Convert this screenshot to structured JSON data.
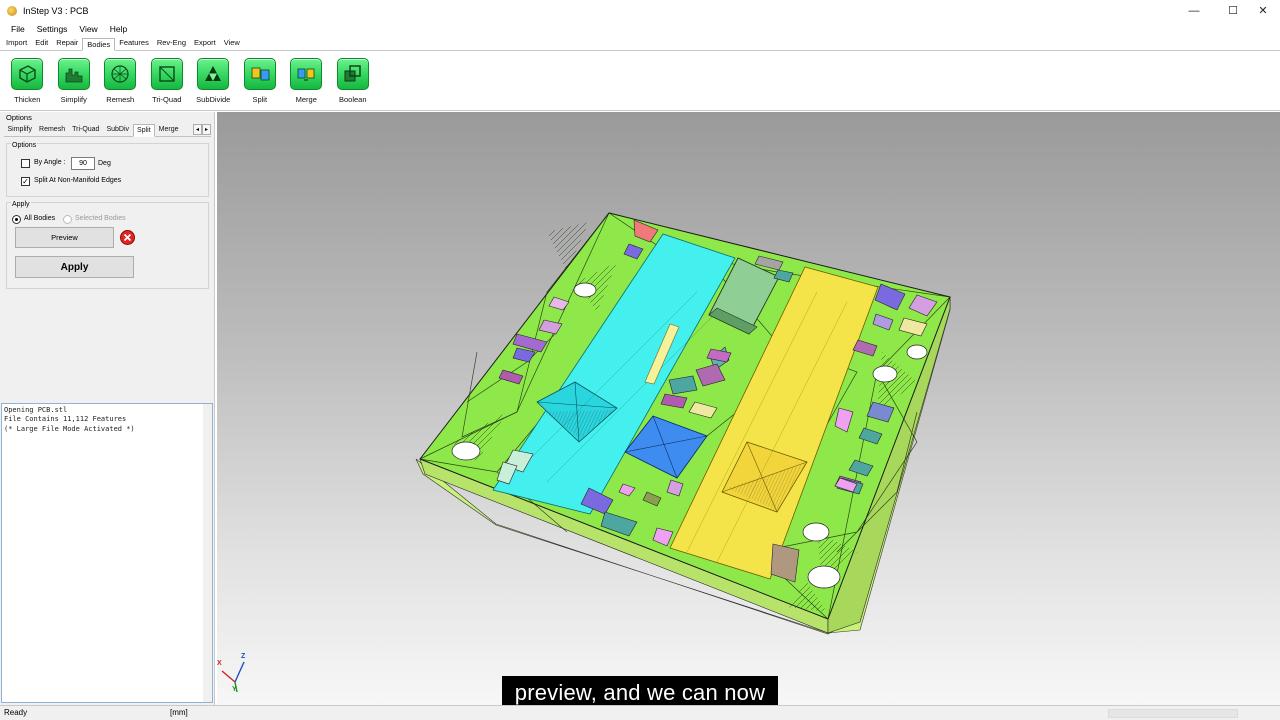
{
  "window": {
    "title": "InStep V3 : PCB",
    "controls": {
      "minimize": "—",
      "maximize": "☐",
      "close": "✕"
    }
  },
  "menu": [
    "File",
    "Settings",
    "View",
    "Help"
  ],
  "ribbon_tabs": [
    {
      "label": "Import",
      "active": false
    },
    {
      "label": "Edit",
      "active": false
    },
    {
      "label": "Repair",
      "active": false
    },
    {
      "label": "Bodies",
      "active": true
    },
    {
      "label": "Features",
      "active": false
    },
    {
      "label": "Rev-Eng",
      "active": false
    },
    {
      "label": "Export",
      "active": false
    },
    {
      "label": "View",
      "active": false
    }
  ],
  "tools": [
    {
      "label": "Thicken",
      "icon": "thicken-icon"
    },
    {
      "label": "Simplify",
      "icon": "simplify-icon"
    },
    {
      "label": "Remesh",
      "icon": "remesh-icon"
    },
    {
      "label": "Tri-Quad",
      "icon": "tri-quad-icon"
    },
    {
      "label": "SubDivide",
      "icon": "subdivide-icon"
    },
    {
      "label": "Split",
      "icon": "split-icon"
    },
    {
      "label": "Merge",
      "icon": "merge-icon"
    },
    {
      "label": "Boolean",
      "icon": "boolean-icon"
    }
  ],
  "options_panel": {
    "header": "Options",
    "subtabs": [
      {
        "label": "Simplify",
        "active": false
      },
      {
        "label": "Remesh",
        "active": false
      },
      {
        "label": "Tri-Quad",
        "active": false
      },
      {
        "label": "SubDiv",
        "active": false
      },
      {
        "label": "Split",
        "active": true
      },
      {
        "label": "Merge",
        "active": false
      }
    ],
    "scroll_left": "◂",
    "scroll_right": "▸",
    "options_group": {
      "title": "Options",
      "by_angle": {
        "label": "By Angle :",
        "checked": false,
        "value": "90",
        "unit": "Deg"
      },
      "split_non_manifold": {
        "label": "Split At Non-Manifold Edges",
        "checked": true,
        "check_glyph": "✓"
      }
    },
    "apply_group": {
      "title": "Apply",
      "all_bodies": {
        "label": "All Bodies",
        "selected": true
      },
      "selected_bodies": {
        "label": "Selected Bodies",
        "selected": false
      },
      "preview_button": "Preview",
      "apply_button": "Apply"
    }
  },
  "log": [
    "Opening PCB.stl",
    "File Contains 11,112 Features",
    "(* Large File Mode Activated *)"
  ],
  "axes": {
    "x": "X",
    "y": "Y",
    "z": "Z"
  },
  "subtitle": "preview, and we can now",
  "status": {
    "ready": "Ready",
    "units": "[mm]"
  },
  "colors": {
    "board": "#8ee84a",
    "board_side": "#c8f07a",
    "cyan_pad": "#43f0ee",
    "yellow_pad": "#f4e44a",
    "blue_chip": "#3f8cf0",
    "tool_green": "#2fd25a",
    "cancel_red": "#e52222"
  }
}
